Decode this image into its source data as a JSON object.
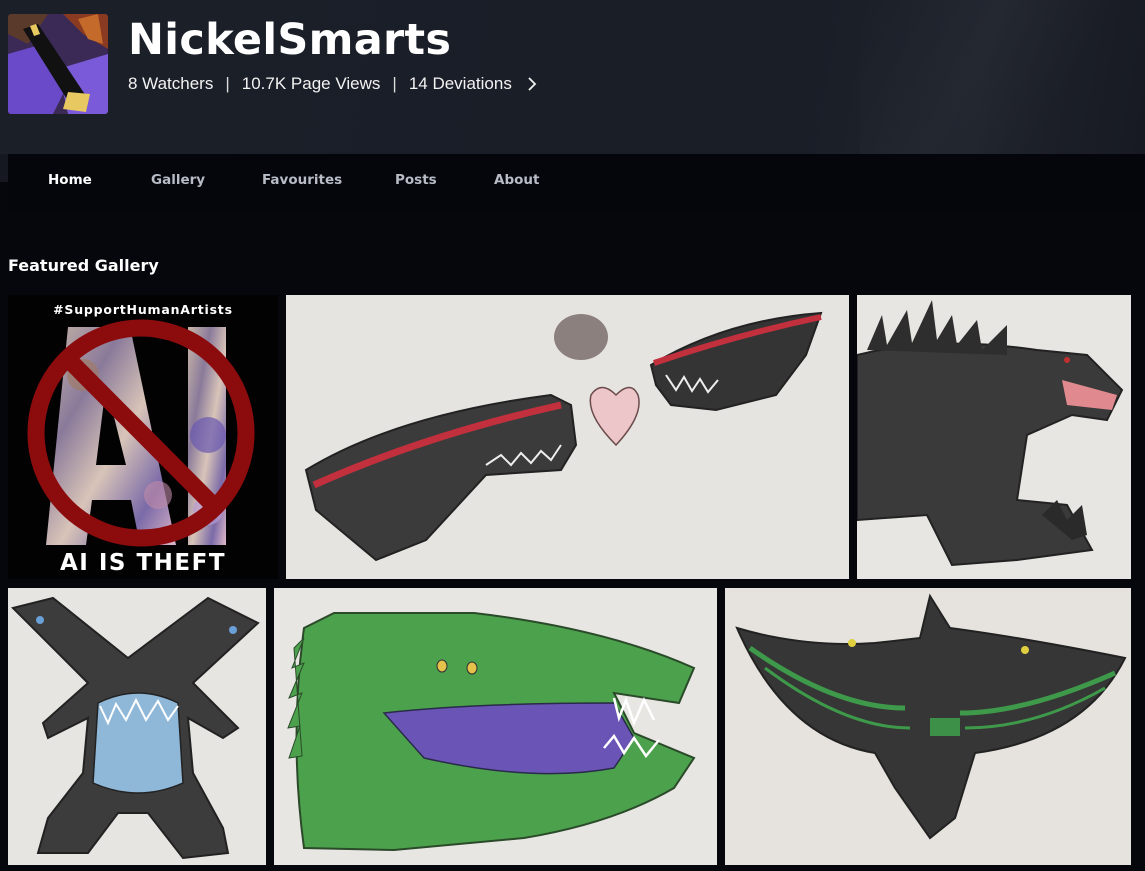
{
  "profile": {
    "username": "NickelSmarts",
    "stats": [
      {
        "key": "watchers",
        "label": "8 Watchers"
      },
      {
        "key": "page_views",
        "label": "10.7K Page Views"
      },
      {
        "key": "deviations",
        "label": "14 Deviations"
      }
    ],
    "separator": "|"
  },
  "nav": {
    "items": [
      {
        "label": "Home",
        "active": true
      },
      {
        "label": "Gallery",
        "active": false
      },
      {
        "label": "Favourites",
        "active": false
      },
      {
        "label": "Posts",
        "active": false
      },
      {
        "label": "About",
        "active": false
      }
    ]
  },
  "featured": {
    "title": "Featured Gallery",
    "thumbnails": [
      {
        "name": "ai-is-theft",
        "hashtag": "#SupportHumanArtists",
        "letters": "AI",
        "caption": "AI IS THEFT"
      },
      {
        "name": "two-shark-heads-heart"
      },
      {
        "name": "black-kaiju-roaring"
      },
      {
        "name": "hammerhead-creature-blue-mouth"
      },
      {
        "name": "green-crocodile-purple-mouth"
      },
      {
        "name": "black-winged-manta-green-stripes"
      }
    ]
  },
  "colors": {
    "header_bg": "#1b1f28",
    "page_bg": "#06070d",
    "nav_active": "#ffffff",
    "nav_inactive": "#b8bcc6",
    "ban_red": "#8c0c0e"
  }
}
